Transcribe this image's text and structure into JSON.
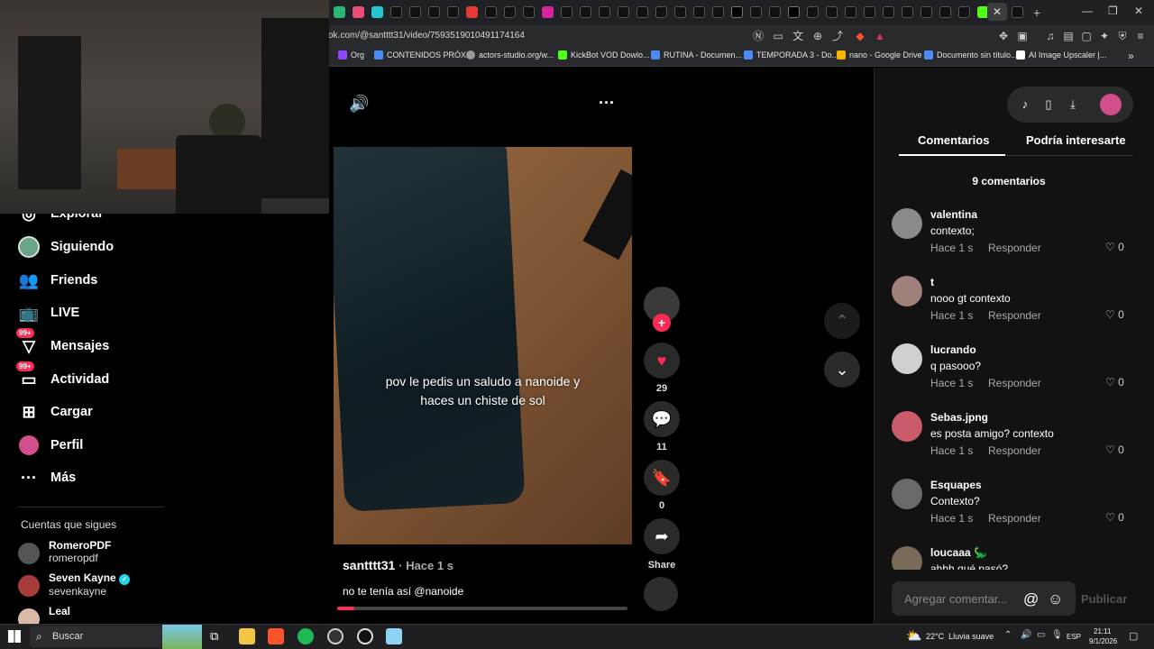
{
  "browser": {
    "url": "ok.com/@santttt31/video/7593519010491174164",
    "bookmarks": [
      "Org",
      "CONTENIDOS PRÓX...",
      "actors-studio.org/w...",
      "KickBot VOD Dowlo...",
      "RUTINA - Documen...",
      "TEMPORADA 3 - Do...",
      "nano - Google Drive",
      "Documento sin título...",
      "AI Image Upscaler |..."
    ]
  },
  "sidebar": {
    "items": [
      {
        "label": "Explorar",
        "icon": "compass-icon",
        "badge": ""
      },
      {
        "label": "Siguiendo",
        "icon": "avatar-icon",
        "badge": ""
      },
      {
        "label": "Friends",
        "icon": "friends-icon",
        "badge": ""
      },
      {
        "label": "LIVE",
        "icon": "live-tv-icon",
        "badge": ""
      },
      {
        "label": "Mensajes",
        "icon": "messages-icon",
        "badge": "99+"
      },
      {
        "label": "Actividad",
        "icon": "activity-icon",
        "badge": "99+"
      },
      {
        "label": "Cargar",
        "icon": "upload-icon",
        "badge": ""
      },
      {
        "label": "Perfil",
        "icon": "profile-icon",
        "badge": ""
      },
      {
        "label": "Más",
        "icon": "more-icon",
        "badge": ""
      }
    ],
    "following_title": "Cuentas que sigues",
    "accounts": [
      {
        "name": "RomeroPDF",
        "handle": "romeropdf",
        "verified": false
      },
      {
        "name": "Seven Kayne",
        "handle": "sevenkayne",
        "verified": true
      },
      {
        "name": "Leal",
        "handle": "",
        "verified": false
      }
    ]
  },
  "video": {
    "caption_line1": "pov le pedis un saludo a nanoide y",
    "caption_line2": "haces un chiste de sol",
    "author": "santttt31",
    "time": "· Hace 1 s",
    "description": "no te tenía así @nanoide",
    "progress": 0.06
  },
  "actions": {
    "likes": "29",
    "comments": "11",
    "saves": "0",
    "share_label": "Share"
  },
  "panel": {
    "tab_comments": "Comentarios",
    "tab_related": "Podría interesarte",
    "comment_count": "9 comentarios",
    "comments": [
      {
        "user": "valentina",
        "text": "contexto;",
        "time": "Hace 1 s",
        "reply": "Responder",
        "likes": "0",
        "color": "#8a8a8a"
      },
      {
        "user": "t",
        "text": "nooo gt contexto",
        "time": "Hace 1 s",
        "reply": "Responder",
        "likes": "0",
        "color": "#a0807a"
      },
      {
        "user": "lucrando",
        "text": "q pasooo?",
        "time": "Hace 1 s",
        "reply": "Responder",
        "likes": "0",
        "color": "#d0d0d0"
      },
      {
        "user": "Sebas.jpng",
        "text": "es posta amigo? contexto",
        "time": "Hace 1 s",
        "reply": "Responder",
        "likes": "0",
        "color": "#c95b6a"
      },
      {
        "user": "Esquapes",
        "text": "Contexto?",
        "time": "Hace 1 s",
        "reply": "Responder",
        "likes": "0",
        "color": "#6a6a6a"
      },
      {
        "user": "loucaaa 🦕",
        "text": "ahhh qué pasó?",
        "time": "",
        "reply": "",
        "likes": "",
        "color": "#7a6a5a"
      }
    ],
    "input_placeholder": "Agregar comentar...",
    "publish_label": "Publicar"
  },
  "taskbar": {
    "search_label": "Buscar",
    "weather": "22°C  Lluvia suave",
    "lang": "ESP",
    "time": "21:11",
    "date": "9/1/2026"
  },
  "colors": {
    "accent": "#fe2c55",
    "panel_bg": "#121212"
  }
}
